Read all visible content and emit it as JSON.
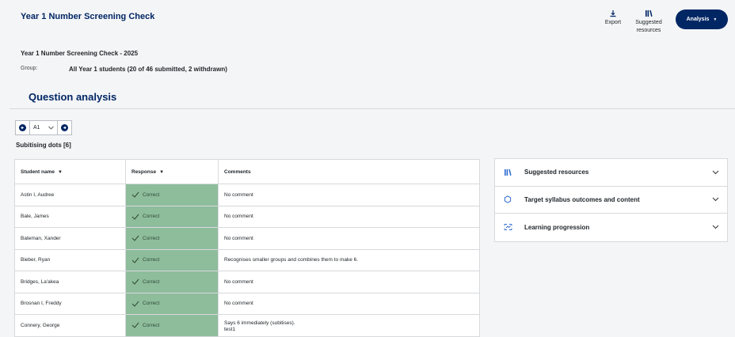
{
  "header": {
    "title": "Year 1 Number Screening Check",
    "export_label": "Export",
    "suggested_line1": "Suggested",
    "suggested_line2": "resources",
    "analysis_label": "Analysis"
  },
  "info": {
    "subtitle": "Year 1 Number Screening Check - 2025",
    "group_label": "Group:",
    "group_value": "All Year 1 students (20 of 46 submitted, 2 withdrawn)"
  },
  "section_title": "Question analysis",
  "question_nav": {
    "selected": "A1"
  },
  "question_label": "Subitising dots [6]",
  "table": {
    "headers": {
      "name": "Student name",
      "response": "Response",
      "comments": "Comments"
    },
    "rows": [
      {
        "name": "Astin I, Audree",
        "response": "Correct",
        "comment": "No comment"
      },
      {
        "name": "Bale, James",
        "response": "Correct",
        "comment": "No comment"
      },
      {
        "name": "Bateman, Xander",
        "response": "Correct",
        "comment": "No comment"
      },
      {
        "name": "Bieber, Ryan",
        "response": "Correct",
        "comment": "Recognises smaller groups and combines them to make 6."
      },
      {
        "name": "Bridges, La'akea",
        "response": "Correct",
        "comment": "No comment"
      },
      {
        "name": "Brosnan I, Freddy",
        "response": "Correct",
        "comment": "No comment"
      },
      {
        "name": "Connery, George",
        "response": "Correct",
        "comment": "Says 6 immediately (subitises).",
        "comment2": "test1"
      }
    ]
  },
  "panel": {
    "items": [
      {
        "label": "Suggested resources"
      },
      {
        "label": "Target syllabus outcomes and content"
      },
      {
        "label": "Learning progression"
      }
    ]
  },
  "colors": {
    "navy": "#002664",
    "correct_bg": "#8ebd9c"
  }
}
